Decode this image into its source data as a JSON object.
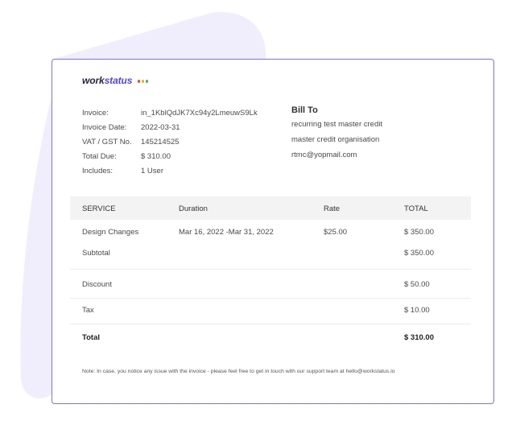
{
  "brand": {
    "part1": "work",
    "part2": "status",
    "dot_colors": [
      "#e74c3c",
      "#f1b11b",
      "#43b75b"
    ]
  },
  "invoice": {
    "labels": [
      "Invoice:",
      "Invoice Date:",
      "VAT / GST No.",
      "Total Due:",
      "Includes:"
    ],
    "values": [
      "in_1KblQdJK7Xc94y2LmeuwS9Lk",
      "2022-03-31",
      "145214525",
      "$ 310.00",
      "1 User"
    ]
  },
  "bill_to": {
    "title": "Bill To",
    "lines": [
      "recurring test master credit",
      "master credit organisation",
      "rtmc@yopmail.com"
    ]
  },
  "table": {
    "headers": [
      "SERVICE",
      "Duration",
      "Rate",
      "TOTAL"
    ],
    "item": {
      "service": "Design Changes",
      "duration": "Mar 16, 2022 -Mar 31, 2022",
      "rate": "$25.00",
      "total": "$ 350.00"
    },
    "subtotal": {
      "label": "Subtotal",
      "value": "$ 350.00"
    },
    "discount": {
      "label": "Discount",
      "value": "$ 50.00"
    },
    "tax": {
      "label": "Tax",
      "value": "$ 10.00"
    },
    "total": {
      "label": "Total",
      "value": "$ 310.00"
    }
  },
  "note": "Note: In case, you notice any issue with the invoice - please feel free to get in touch with our support team at hello@workstatus.io",
  "colors": {
    "accent": "#7e73d8",
    "blob": "#f0eefc",
    "header_bg": "#f3f3f3"
  }
}
